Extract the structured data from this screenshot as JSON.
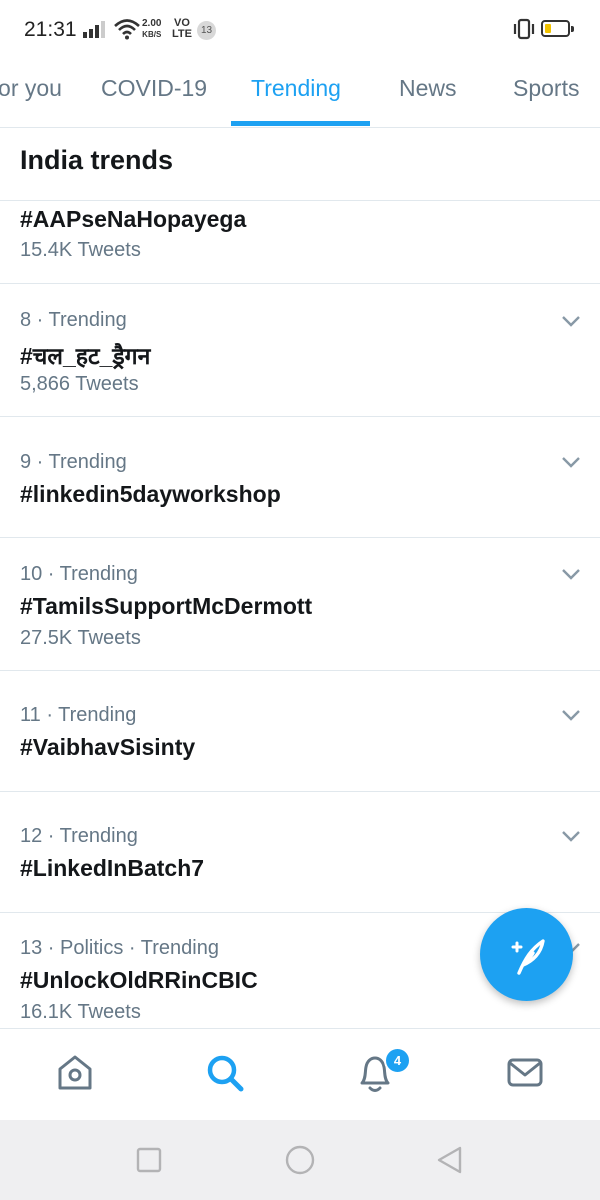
{
  "status_bar": {
    "time": "21:31",
    "speed_value": "2.00",
    "speed_unit": "KB/S",
    "volte_top": "VO",
    "volte_bottom": "LTE",
    "notification_count": "13"
  },
  "tabs": [
    {
      "label": "For you",
      "active": false
    },
    {
      "label": "COVID-19",
      "active": false
    },
    {
      "label": "Trending",
      "active": true
    },
    {
      "label": "News",
      "active": false
    },
    {
      "label": "Sports",
      "active": false
    }
  ],
  "section_title": "India trends",
  "trends": [
    {
      "meta": "",
      "name": "#AAPseNaHopayega",
      "count": "15.4K Tweets"
    },
    {
      "meta": "8 · Trending",
      "name": "#चल_हट_ड्रैगन",
      "count": "5,866 Tweets"
    },
    {
      "meta": "9 · Trending",
      "name": "#linkedin5dayworkshop",
      "count": ""
    },
    {
      "meta": "10 · Trending",
      "name": "#TamilsSupportMcDermott",
      "count": "27.5K Tweets"
    },
    {
      "meta": "11 · Trending",
      "name": "#VaibhavSisinty",
      "count": ""
    },
    {
      "meta": "12 · Trending",
      "name": "#LinkedInBatch7",
      "count": ""
    },
    {
      "meta": "13 · Politics · Trending",
      "name": "#UnlockOldRRinCBIC",
      "count": "16.1K Tweets"
    }
  ],
  "bottom_nav": {
    "items": [
      "home-icon",
      "search-icon",
      "notifications-icon",
      "messages-icon"
    ],
    "active": "search-icon",
    "notification_badge": "4"
  },
  "colors": {
    "accent": "#1da1f2",
    "text_primary": "#14171a",
    "text_secondary": "#657786",
    "divider": "#e1e8ed"
  }
}
